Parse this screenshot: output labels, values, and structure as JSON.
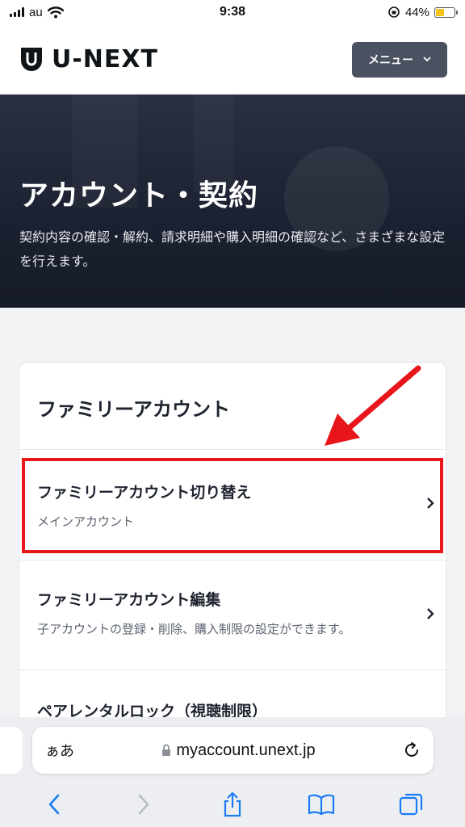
{
  "status_bar": {
    "carrier": "au",
    "time": "9:38",
    "battery": "44%",
    "battery_level": 0.44
  },
  "header": {
    "logo_text": "U-NEXT",
    "menu_label": "メニュー"
  },
  "hero": {
    "title": "アカウント・契約",
    "description": "契約内容の確認・解約、請求明細や購入明細の確認など、さまざまな設定を行えます。"
  },
  "card": {
    "title": "ファミリーアカウント",
    "items": [
      {
        "title": "ファミリーアカウント切り替え",
        "subtitle": "メインアカウント"
      },
      {
        "title": "ファミリーアカウント編集",
        "subtitle": "子アカウントの登録・削除、購入制限の設定ができます。"
      },
      {
        "title": "ペアレンタルロック（視聴制限）"
      }
    ]
  },
  "browser": {
    "text_size_label": "ぁあ",
    "url": "myaccount.unext.jp"
  },
  "colors": {
    "highlight": "#e8151b",
    "menu_bg": "#4a5160",
    "ios_blue": "#1a7cf5"
  }
}
